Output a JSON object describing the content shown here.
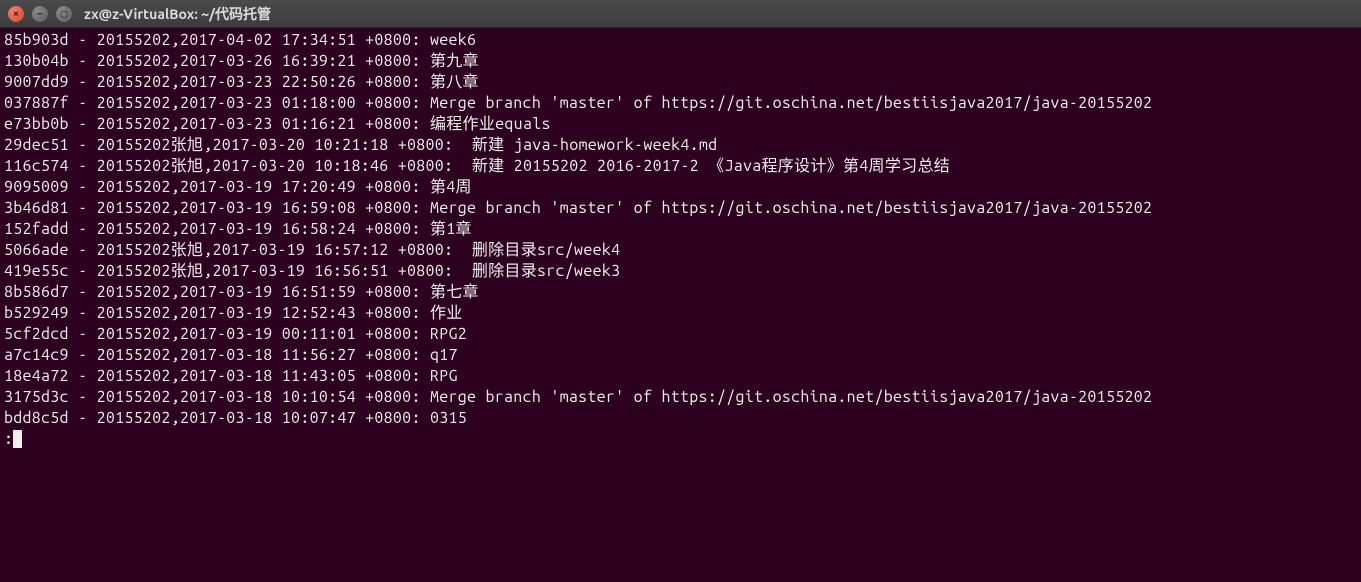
{
  "window": {
    "title": "zx@z-VirtualBox: ~/代码托管"
  },
  "commits": [
    {
      "hash": "85b903d",
      "author": "20155202",
      "date": "2017-04-02 17:34:51 +0800",
      "msg": "week6"
    },
    {
      "hash": "130b04b",
      "author": "20155202",
      "date": "2017-03-26 16:39:21 +0800",
      "msg": "第九章"
    },
    {
      "hash": "9007dd9",
      "author": "20155202",
      "date": "2017-03-23 22:50:26 +0800",
      "msg": "第八章"
    },
    {
      "hash": "037887f",
      "author": "20155202",
      "date": "2017-03-23 01:18:00 +0800",
      "msg": "Merge branch 'master' of https://git.oschina.net/bestiisjava2017/java-20155202"
    },
    {
      "hash": "e73bb0b",
      "author": "20155202",
      "date": "2017-03-23 01:16:21 +0800",
      "msg": "编程作业equals"
    },
    {
      "hash": "29dec51",
      "author": "20155202张旭",
      "date": "2017-03-20 10:21:18 +0800",
      "msg": " 新建 java-homework-week4.md"
    },
    {
      "hash": "116c574",
      "author": "20155202张旭",
      "date": "2017-03-20 10:18:46 +0800",
      "msg": " 新建 20155202 2016-2017-2 《Java程序设计》第4周学习总结"
    },
    {
      "hash": "9095009",
      "author": "20155202",
      "date": "2017-03-19 17:20:49 +0800",
      "msg": "第4周"
    },
    {
      "hash": "3b46d81",
      "author": "20155202",
      "date": "2017-03-19 16:59:08 +0800",
      "msg": "Merge branch 'master' of https://git.oschina.net/bestiisjava2017/java-20155202"
    },
    {
      "hash": "152fadd",
      "author": "20155202",
      "date": "2017-03-19 16:58:24 +0800",
      "msg": "第1章"
    },
    {
      "hash": "5066ade",
      "author": "20155202张旭",
      "date": "2017-03-19 16:57:12 +0800",
      "msg": " 删除目录src/week4"
    },
    {
      "hash": "419e55c",
      "author": "20155202张旭",
      "date": "2017-03-19 16:56:51 +0800",
      "msg": " 删除目录src/week3"
    },
    {
      "hash": "8b586d7",
      "author": "20155202",
      "date": "2017-03-19 16:51:59 +0800",
      "msg": "第七章"
    },
    {
      "hash": "b529249",
      "author": "20155202",
      "date": "2017-03-19 12:52:43 +0800",
      "msg": "作业"
    },
    {
      "hash": "5cf2dcd",
      "author": "20155202",
      "date": "2017-03-19 00:11:01 +0800",
      "msg": "RPG2"
    },
    {
      "hash": "a7c14c9",
      "author": "20155202",
      "date": "2017-03-18 11:56:27 +0800",
      "msg": "q17"
    },
    {
      "hash": "18e4a72",
      "author": "20155202",
      "date": "2017-03-18 11:43:05 +0800",
      "msg": "RPG"
    },
    {
      "hash": "3175d3c",
      "author": "20155202",
      "date": "2017-03-18 10:10:54 +0800",
      "msg": "Merge branch 'master' of https://git.oschina.net/bestiisjava2017/java-20155202"
    },
    {
      "hash": "bdd8c5d",
      "author": "20155202",
      "date": "2017-03-18 10:07:47 +0800",
      "msg": "0315"
    }
  ],
  "prompt": ":"
}
